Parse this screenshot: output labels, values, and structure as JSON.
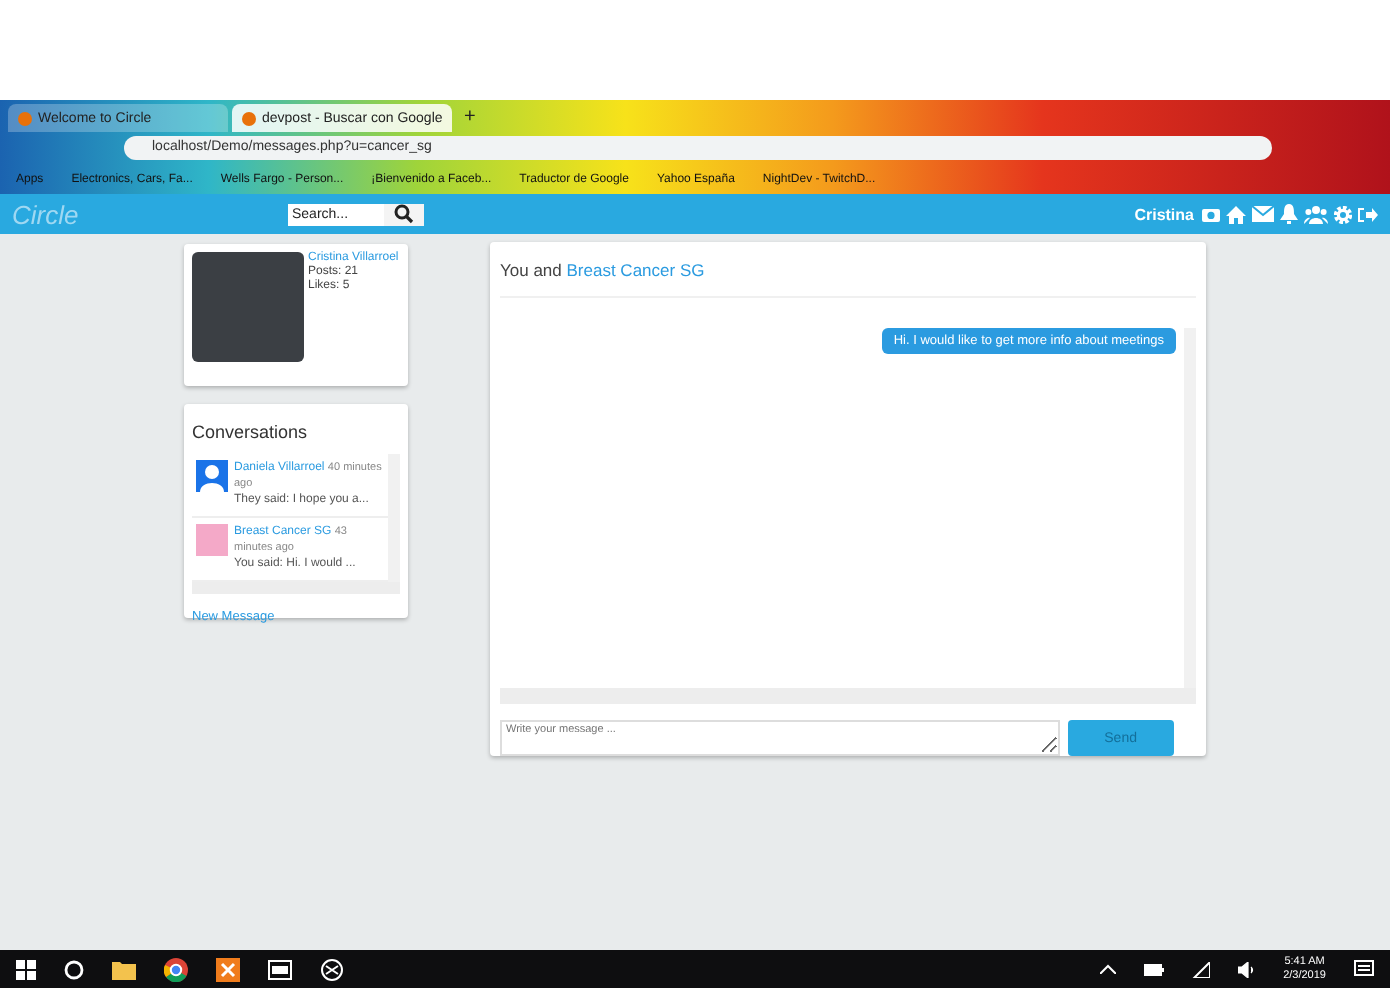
{
  "browser": {
    "tabs": [
      {
        "title": "Welcome to Circle",
        "selected": false
      },
      {
        "title": "devpost - Buscar con Google",
        "selected": true
      }
    ],
    "new_tab": "+",
    "url": "localhost/Demo/messages.php?u=cancer_sg",
    "bookmarks": [
      "Apps",
      "Electronics, Cars, Fa...",
      "Wells Fargo - Person...",
      "¡Bienvenido a Faceb...",
      "Traductor de Google",
      "Yahoo España",
      "NightDev - TwitchD..."
    ]
  },
  "navbar": {
    "logo": "Circle",
    "search_placeholder": "Search...",
    "user": "Cristina"
  },
  "profile": {
    "name": "Cristina Villarroel",
    "posts": "Posts: 21",
    "likes": "Likes: 5"
  },
  "conversations": {
    "title": "Conversations",
    "items": [
      {
        "name": "Daniela Villarroel",
        "time": "40 minutes ago",
        "snippet": "They said: I hope you a...",
        "kind": "silhouette"
      },
      {
        "name": "Breast Cancer SG",
        "time": "43 minutes ago",
        "snippet": "You said: Hi. I would ...",
        "kind": "photo"
      }
    ],
    "new_message": "New Message"
  },
  "chat": {
    "prefix": "You and",
    "partner": "Breast Cancer SG",
    "messages": [
      {
        "text": "Hi. I would like to get more info about meetings",
        "mine": true
      }
    ],
    "placeholder": "Write your message ...",
    "send": "Send"
  },
  "taskbar": {
    "time": "5:41 AM",
    "date": "2/3/2019"
  }
}
